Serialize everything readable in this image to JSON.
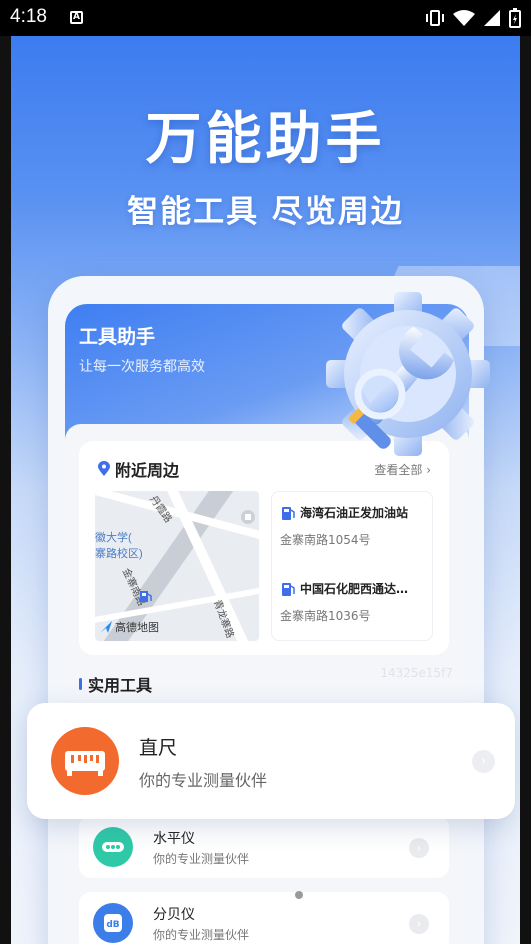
{
  "status_bar": {
    "time": "4:18",
    "notification_letter": "A"
  },
  "hero": {
    "title": "万能助手",
    "subtitle": "智能工具 尽览周边"
  },
  "app_header": {
    "title": "工具助手",
    "subtitle": "让每一次服务都高效"
  },
  "nearby": {
    "title": "附近周边",
    "view_all": "查看全部",
    "map_labels": [
      "丹霞路",
      "徽大学(",
      "寨路校区)",
      "金寨南路",
      "青龙寨路"
    ],
    "map_logo": "高德地图",
    "stations": [
      {
        "name": "海湾石油正发加油站",
        "address": "金寨南路1054号"
      },
      {
        "name": "中国石化肥西通达…",
        "address": "金寨南路1036号"
      }
    ]
  },
  "tools": {
    "title": "实用工具",
    "watermark": "14325e15f7",
    "items": [
      {
        "name": "水平仪",
        "desc": "你的专业测量伙伴",
        "icon": "level-icon",
        "color": "#2fc9a8"
      },
      {
        "name": "分贝仪",
        "desc": "你的专业测量伙伴",
        "icon": "decibel-icon",
        "color": "#3b7de9"
      }
    ]
  },
  "popup": {
    "name": "直尺",
    "desc": "你的专业测量伙伴",
    "icon": "ruler-icon",
    "color": "#f26a2e"
  }
}
